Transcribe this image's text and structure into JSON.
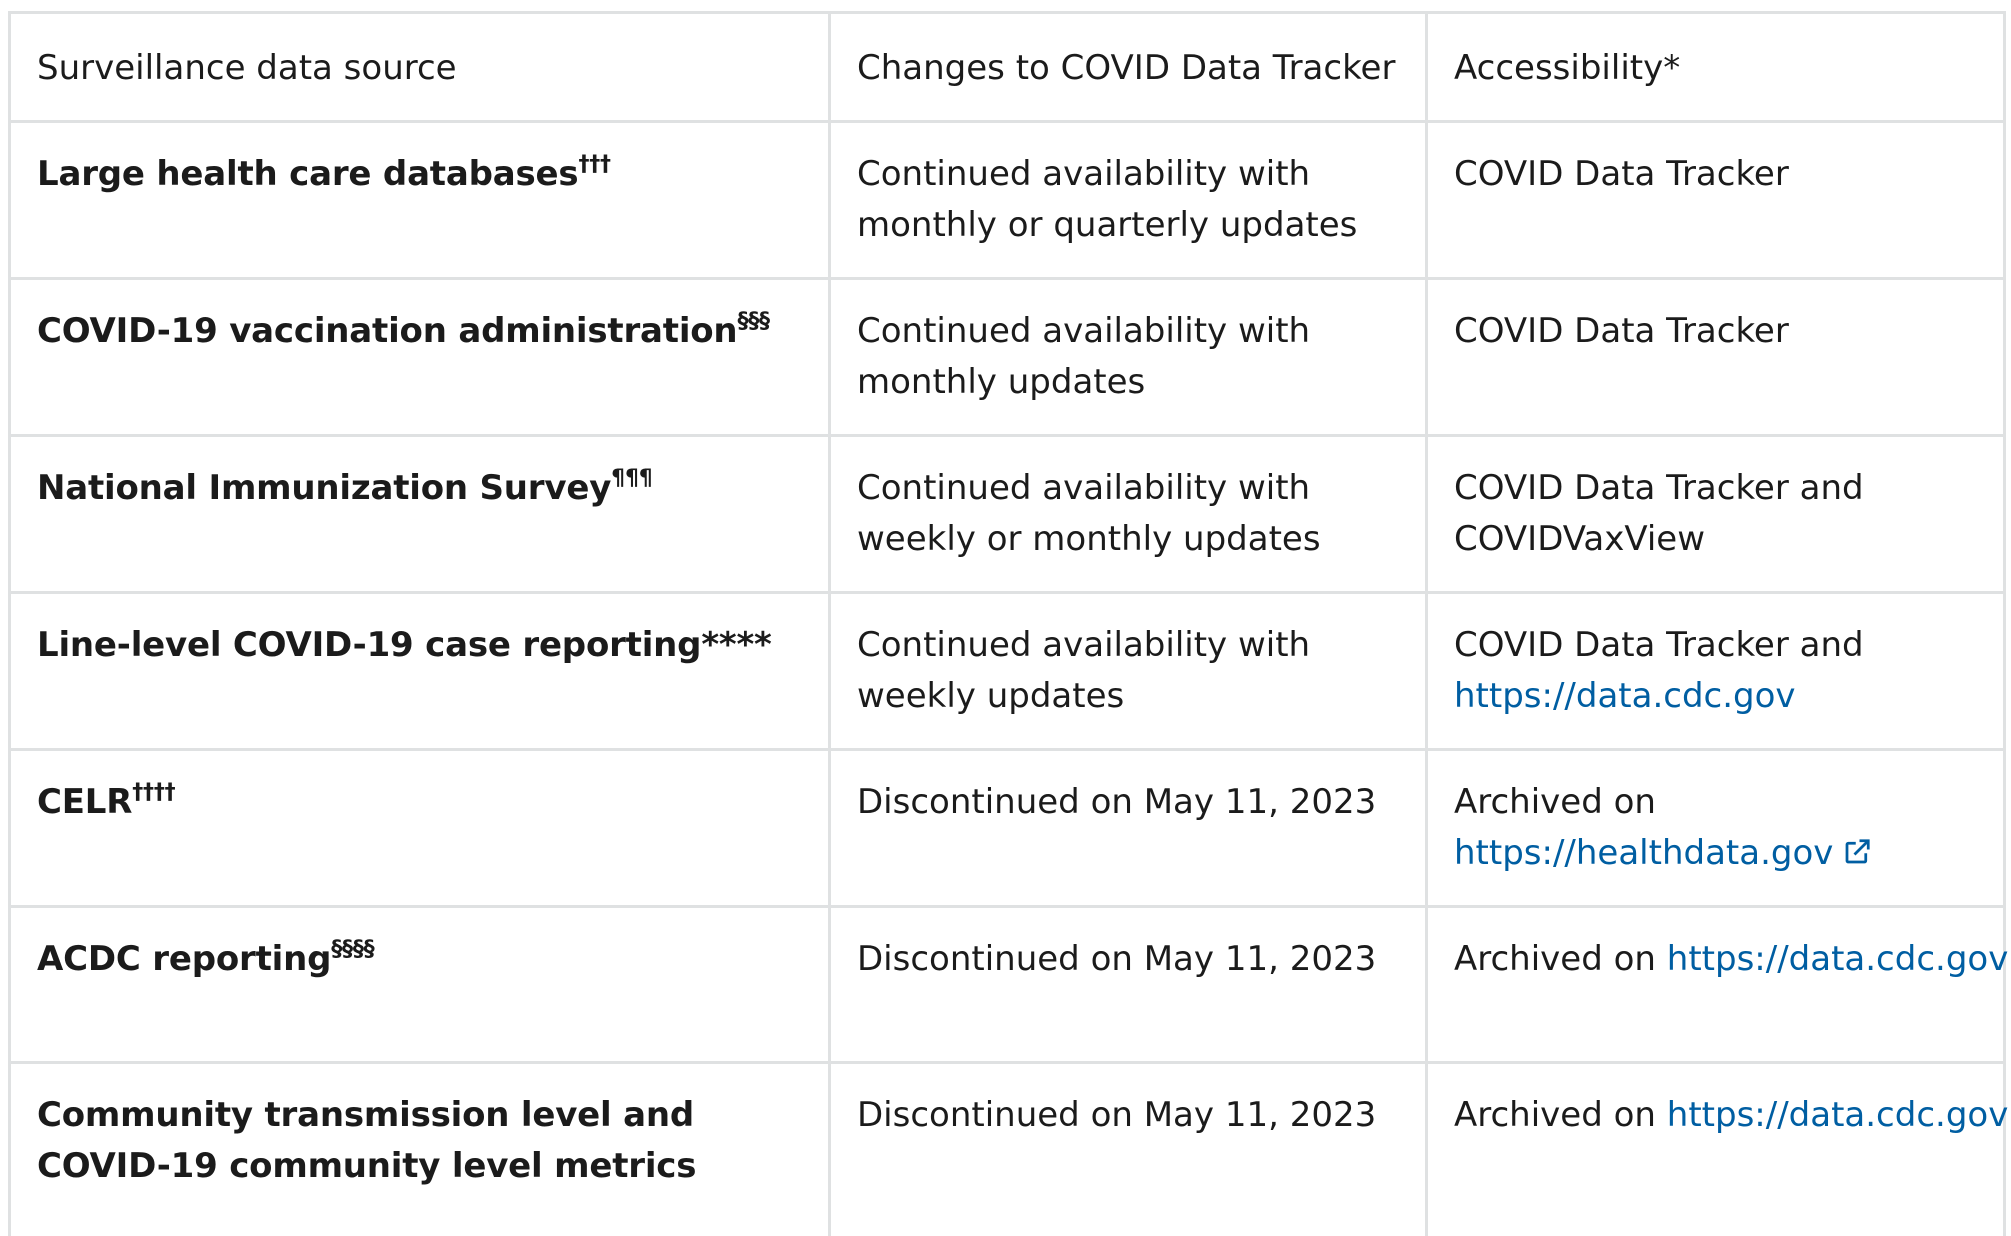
{
  "table": {
    "headers": [
      "Surveillance data source",
      "Changes to COVID Data Tracker",
      "Accessibility*"
    ],
    "rows": [
      {
        "source": "Large health care databases",
        "source_sup": "†††",
        "changes": "Continued availability with monthly or quarterly updates",
        "access_text": "COVID Data Tracker",
        "access_link": ""
      },
      {
        "source": "COVID-19 vaccination administration",
        "source_sup": "§§§",
        "changes": "Continued availability with monthly updates",
        "access_text": "COVID Data Tracker",
        "access_link": ""
      },
      {
        "source": "National Immunization Survey",
        "source_sup": "¶¶¶",
        "changes": "Continued availability with weekly or monthly updates",
        "access_text": "COVID Data Tracker and COVIDVaxView",
        "access_link": ""
      },
      {
        "source": "Line-level COVID-19 case reporting****",
        "source_sup": "",
        "changes": "Continued availability with weekly updates",
        "access_text": "COVID Data Tracker and",
        "access_link": "https://data.cdc.gov"
      },
      {
        "source": "CELR",
        "source_sup": "††††",
        "changes": "Discontinued on May 11, 2023",
        "access_text": "Archived on",
        "access_link": "https://healthdata.gov",
        "external_icon": "external-link-icon"
      },
      {
        "source": "ACDC reporting",
        "source_sup": "§§§§",
        "changes": "Discontinued on May 11, 2023",
        "access_text": "Archived on",
        "access_link": "https://data.cdc.gov"
      },
      {
        "source": "Community transmission level and COVID-19 community level metrics",
        "source_sup": "",
        "changes": "Discontinued on May 11, 2023",
        "access_text": "Archived on",
        "access_link": "https://data.cdc.gov"
      }
    ]
  },
  "colors": {
    "link": "#005ea2",
    "border": "#dfe1e2",
    "text": "#1b1b1b"
  }
}
